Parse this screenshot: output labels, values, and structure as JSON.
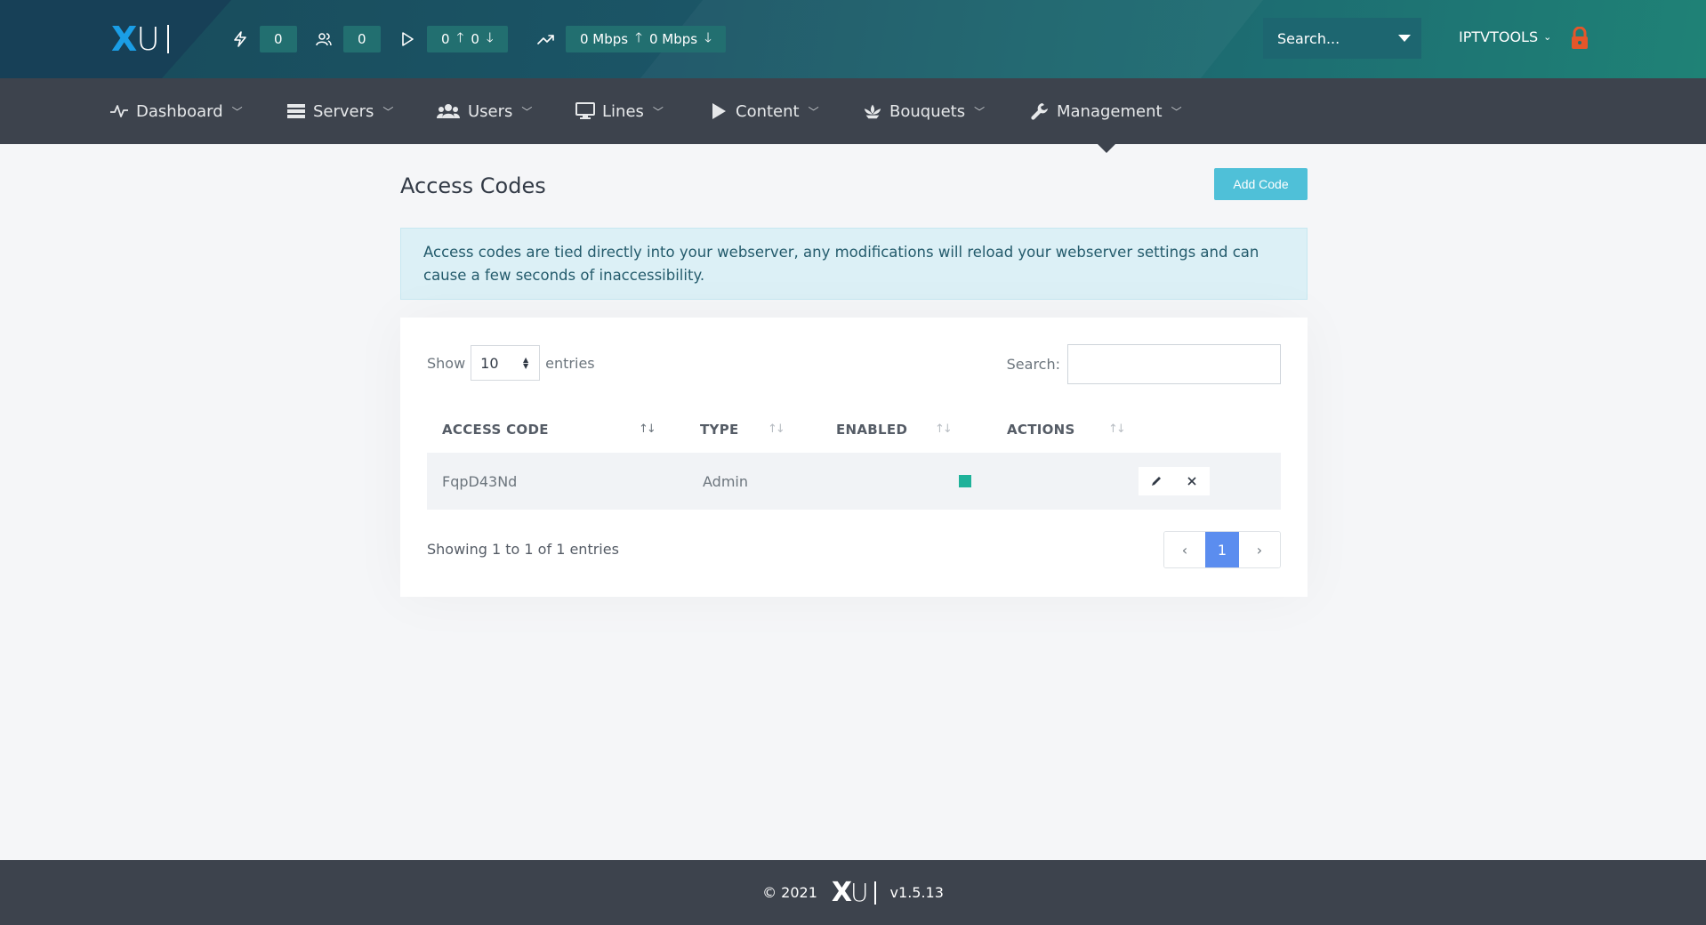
{
  "brand": {
    "logo_x": "X",
    "logo_u": "U"
  },
  "topbar": {
    "stats": [
      {
        "icon": "bolt-icon",
        "value": "0"
      },
      {
        "icon": "users-icon",
        "value": "0"
      },
      {
        "icon": "play-icon",
        "up": "0",
        "down": "0"
      },
      {
        "icon": "trending-up-icon",
        "up": "0 Mbps",
        "down": "0 Mbps"
      }
    ],
    "search_placeholder": "Search...",
    "username": "IPTVTOOLS"
  },
  "nav": [
    {
      "label": "Dashboard",
      "icon": "pulse-icon"
    },
    {
      "label": "Servers",
      "icon": "server-icon"
    },
    {
      "label": "Users",
      "icon": "users-icon"
    },
    {
      "label": "Lines",
      "icon": "monitor-icon"
    },
    {
      "label": "Content",
      "icon": "play-icon"
    },
    {
      "label": "Bouquets",
      "icon": "bouquet-icon"
    },
    {
      "label": "Management",
      "icon": "wrench-icon"
    }
  ],
  "page": {
    "title": "Access Codes",
    "add_button": "Add Code",
    "alert": "Access codes are tied directly into your webserver, any modifications will reload your webserver settings and can cause a few seconds of inaccessibility."
  },
  "table": {
    "show_label": "Show",
    "entries_label": "entries",
    "page_size": "10",
    "search_label": "Search:",
    "columns": [
      "ACCESS CODE",
      "TYPE",
      "ENABLED",
      "ACTIONS"
    ],
    "rows": [
      {
        "code": "FqpD43Nd",
        "type": "Admin",
        "enabled": true
      }
    ],
    "info": "Showing 1 to 1 of 1 entries",
    "pagination": {
      "prev": "‹",
      "current": "1",
      "next": "›"
    }
  },
  "footer": {
    "copyright": "© 2021",
    "version": "v1.5.13"
  },
  "colors": {
    "accent": "#4fc0d8",
    "enabled": "#1fb29a",
    "page_active": "#5b8def",
    "lock": "#e5562a"
  }
}
